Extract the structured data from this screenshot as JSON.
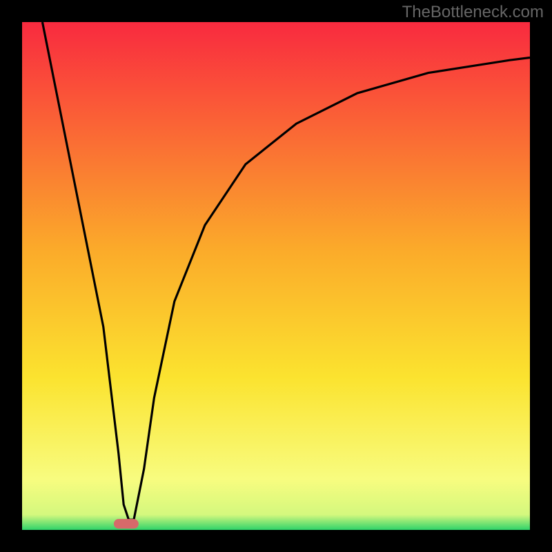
{
  "watermark": "TheBottleneck.com",
  "chart_data": {
    "type": "line",
    "title": "",
    "xlabel": "",
    "ylabel": "",
    "xlim": [
      0,
      100
    ],
    "ylim": [
      0,
      100
    ],
    "series": [
      {
        "name": "curve",
        "x": [
          4,
          8,
          12,
          16,
          19,
          20,
          21,
          22,
          24,
          26,
          30,
          36,
          44,
          54,
          66,
          80,
          96,
          100
        ],
        "y": [
          100,
          80,
          60,
          40,
          15,
          5,
          2,
          2,
          12,
          26,
          45,
          60,
          72,
          80,
          86,
          90,
          92.5,
          93
        ]
      }
    ],
    "marker": {
      "x": 20.5,
      "y": 1.2
    },
    "gradient_stops": [
      {
        "offset": 0,
        "color": "#f92a3f"
      },
      {
        "offset": 45,
        "color": "#fbab2a"
      },
      {
        "offset": 70,
        "color": "#fbe32f"
      },
      {
        "offset": 90,
        "color": "#f8fc7f"
      },
      {
        "offset": 97,
        "color": "#d4f87e"
      },
      {
        "offset": 100,
        "color": "#2fd36a"
      }
    ],
    "frame_thickness_pct": 4
  }
}
